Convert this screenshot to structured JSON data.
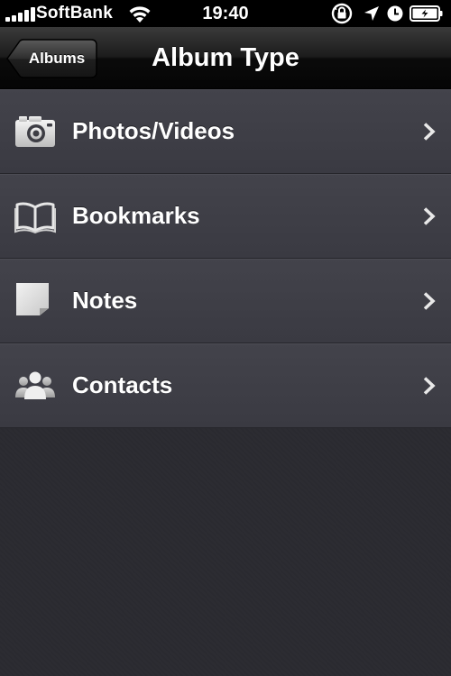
{
  "status_bar": {
    "carrier": "SoftBank",
    "time": "19:40",
    "signal_bars": 5
  },
  "nav_bar": {
    "back_label": "Albums",
    "title": "Album Type"
  },
  "list": {
    "items": [
      {
        "label": "Photos/Videos",
        "icon": "camera-icon"
      },
      {
        "label": "Bookmarks",
        "icon": "book-icon"
      },
      {
        "label": "Notes",
        "icon": "note-icon"
      },
      {
        "label": "Contacts",
        "icon": "contacts-icon"
      }
    ]
  },
  "colors": {
    "background": "#2b2b31",
    "row": "#3e3e46",
    "nav_bar": "#111111",
    "text": "#ffffff"
  }
}
